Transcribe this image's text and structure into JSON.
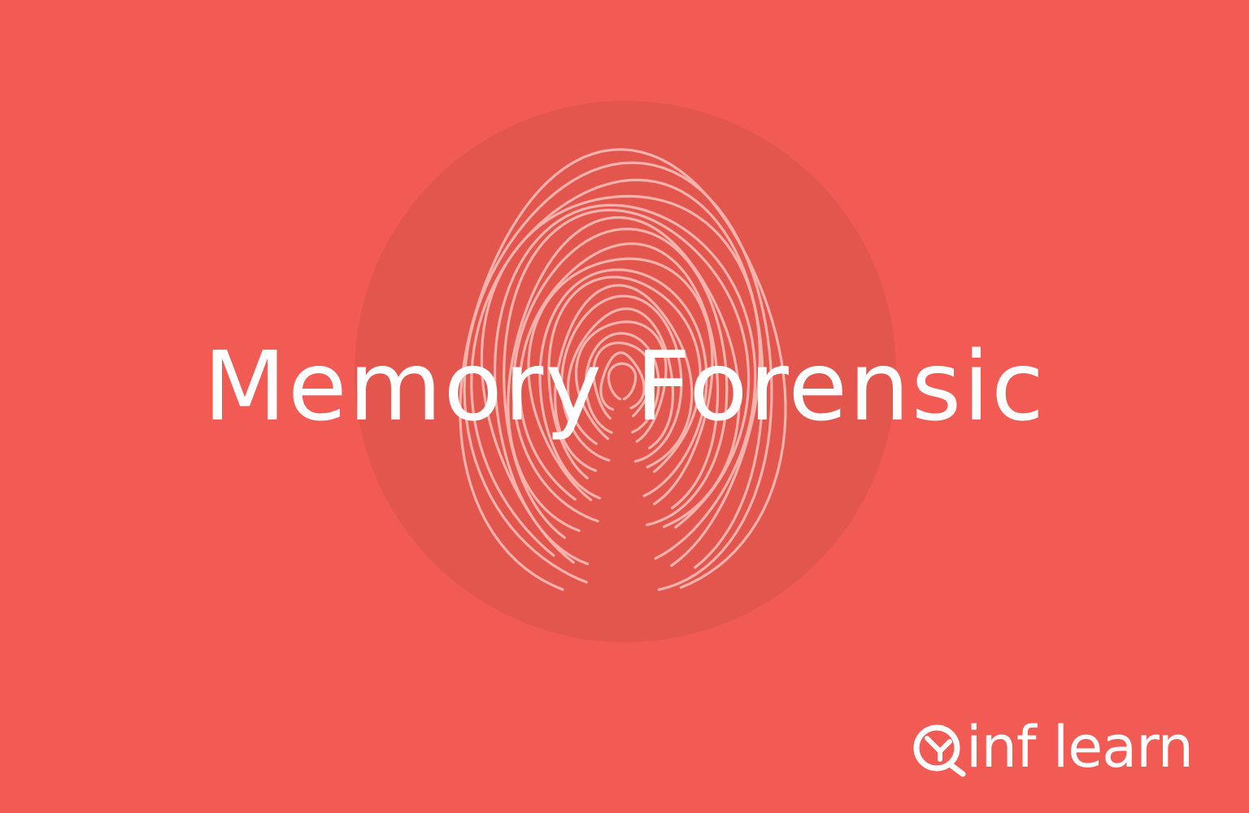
{
  "background_color": "#f25b53",
  "circle_color": "#e3564d",
  "fingerprint_color": "#f8b7b2",
  "title": "Memory Forensic",
  "logo": {
    "icon": "inflearn-logo-icon",
    "text": "inf learn"
  }
}
